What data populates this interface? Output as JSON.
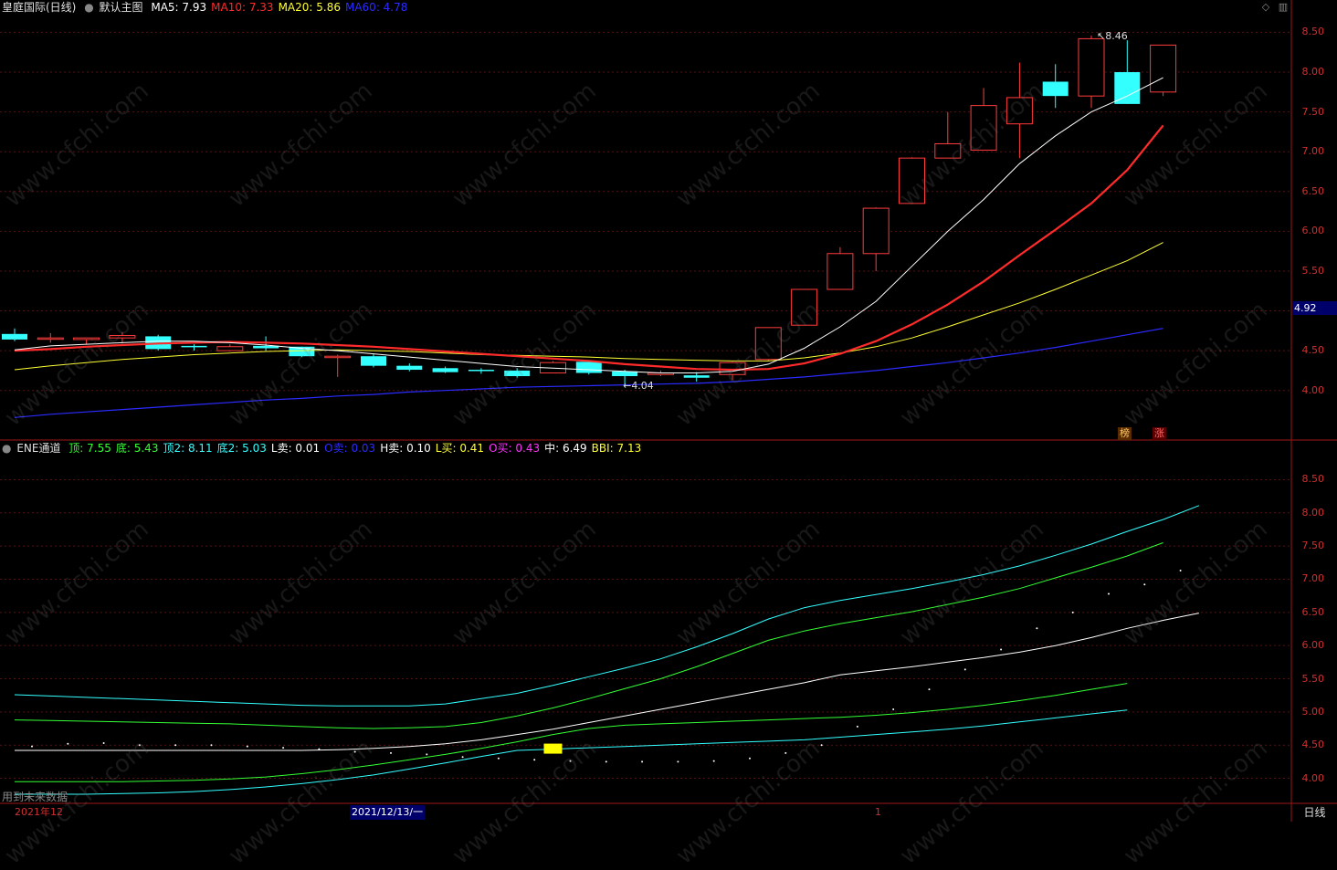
{
  "header": {
    "stock": "皇庭国际(日线)",
    "template": "默认主图",
    "ma": [
      {
        "label": "MA5: 7.93",
        "color": "#ffffff"
      },
      {
        "label": "MA10: 7.33",
        "color": "#ff2b2b"
      },
      {
        "label": "MA20: 5.86",
        "color": "#ffff33"
      },
      {
        "label": "MA60: 4.78",
        "color": "#2b2bff"
      }
    ]
  },
  "ene_header": {
    "name": "ENE通道",
    "items": [
      {
        "label": "顶: 7.55",
        "color": "#33ff33"
      },
      {
        "label": "底: 5.43",
        "color": "#33ff33"
      },
      {
        "label": "顶2: 8.11",
        "color": "#33ffff"
      },
      {
        "label": "底2: 5.03",
        "color": "#33ffff"
      },
      {
        "label": "L卖: 0.01",
        "color": "#ffffff"
      },
      {
        "label": "O卖: 0.03",
        "color": "#2b2bff"
      },
      {
        "label": "H卖: 0.10",
        "color": "#ffffff"
      },
      {
        "label": "L买: 0.41",
        "color": "#ffff33"
      },
      {
        "label": "O买: 0.43",
        "color": "#ff33ff"
      },
      {
        "label": "中: 6.49",
        "color": "#ffffff"
      },
      {
        "label": "BBI: 7.13",
        "color": "#ffff33"
      }
    ]
  },
  "main_axis": {
    "ticks": [
      "8.50",
      "8.00",
      "7.50",
      "7.00",
      "6.50",
      "6.00",
      "5.50",
      "5.00",
      "4.50",
      "4.00"
    ]
  },
  "sub_axis": {
    "ticks": [
      "8.50",
      "8.00",
      "7.50",
      "7.00",
      "6.50",
      "6.00",
      "5.50",
      "5.00",
      "4.50",
      "4.00"
    ]
  },
  "current_price": "4.92",
  "annotations": {
    "high": "8.46",
    "low": "4.04",
    "badge_1": "榜",
    "badge_2": "涨"
  },
  "footer": {
    "note": "用到未来数据",
    "time_left": "2021年12",
    "time_cursor": "2021/12/13/一",
    "time_mark": "1",
    "period": "日线"
  },
  "watermark": "www.cfchi.com",
  "chart_data": {
    "type": "candlestick",
    "candles": [
      {
        "o": 4.71,
        "h": 4.78,
        "l": 4.62,
        "c": 4.64
      },
      {
        "o": 4.66,
        "h": 4.72,
        "l": 4.6,
        "c": 4.66
      },
      {
        "o": 4.64,
        "h": 4.66,
        "l": 4.58,
        "c": 4.66
      },
      {
        "o": 4.66,
        "h": 4.73,
        "l": 4.59,
        "c": 4.69
      },
      {
        "o": 4.68,
        "h": 4.7,
        "l": 4.5,
        "c": 4.52
      },
      {
        "o": 4.56,
        "h": 4.58,
        "l": 4.5,
        "c": 4.55
      },
      {
        "o": 4.5,
        "h": 4.58,
        "l": 4.49,
        "c": 4.55
      },
      {
        "o": 4.56,
        "h": 4.68,
        "l": 4.5,
        "c": 4.53
      },
      {
        "o": 4.55,
        "h": 4.55,
        "l": 4.42,
        "c": 4.43
      },
      {
        "o": 4.43,
        "h": 4.45,
        "l": 4.17,
        "c": 4.43
      },
      {
        "o": 4.43,
        "h": 4.46,
        "l": 4.29,
        "c": 4.31
      },
      {
        "o": 4.31,
        "h": 4.34,
        "l": 4.24,
        "c": 4.26
      },
      {
        "o": 4.28,
        "h": 4.3,
        "l": 4.22,
        "c": 4.23
      },
      {
        "o": 4.26,
        "h": 4.28,
        "l": 4.21,
        "c": 4.25
      },
      {
        "o": 4.25,
        "h": 4.28,
        "l": 4.16,
        "c": 4.18
      },
      {
        "o": 4.22,
        "h": 4.37,
        "l": 4.22,
        "c": 4.35
      },
      {
        "o": 4.36,
        "h": 4.38,
        "l": 4.2,
        "c": 4.22
      },
      {
        "o": 4.24,
        "h": 4.26,
        "l": 4.04,
        "c": 4.18
      },
      {
        "o": 4.2,
        "h": 4.25,
        "l": 4.18,
        "c": 4.22
      },
      {
        "o": 4.19,
        "h": 4.23,
        "l": 4.11,
        "c": 4.16
      },
      {
        "o": 4.2,
        "h": 4.36,
        "l": 4.13,
        "c": 4.35
      },
      {
        "o": 4.39,
        "h": 4.78,
        "l": 4.37,
        "c": 4.79
      },
      {
        "o": 4.82,
        "h": 5.27,
        "l": 4.82,
        "c": 5.27
      },
      {
        "o": 5.27,
        "h": 5.8,
        "l": 5.27,
        "c": 5.72
      },
      {
        "o": 5.72,
        "h": 6.3,
        "l": 5.5,
        "c": 6.29
      },
      {
        "o": 6.35,
        "h": 6.93,
        "l": 6.35,
        "c": 6.92
      },
      {
        "o": 6.92,
        "h": 7.5,
        "l": 6.92,
        "c": 7.1
      },
      {
        "o": 7.02,
        "h": 7.8,
        "l": 7.02,
        "c": 7.58
      },
      {
        "o": 7.35,
        "h": 8.12,
        "l": 6.92,
        "c": 7.68
      },
      {
        "o": 7.88,
        "h": 8.1,
        "l": 7.55,
        "c": 7.7
      },
      {
        "o": 7.7,
        "h": 8.46,
        "l": 7.55,
        "c": 8.42
      },
      {
        "o": 8.0,
        "h": 8.4,
        "l": 7.6,
        "c": 7.6
      },
      {
        "o": 7.75,
        "h": 8.34,
        "l": 7.7,
        "c": 8.34
      }
    ],
    "ma5": [
      4.51,
      4.56,
      4.58,
      4.6,
      4.62,
      4.62,
      4.6,
      4.57,
      4.53,
      4.5,
      4.46,
      4.42,
      4.38,
      4.34,
      4.3,
      4.28,
      4.26,
      4.24,
      4.22,
      4.22,
      4.24,
      4.33,
      4.53,
      4.8,
      5.12,
      5.56,
      6.0,
      6.4,
      6.85,
      7.2,
      7.5,
      7.7,
      7.93
    ],
    "ma10": [
      4.5,
      4.52,
      4.55,
      4.57,
      4.59,
      4.6,
      4.61,
      4.6,
      4.59,
      4.57,
      4.55,
      4.52,
      4.49,
      4.46,
      4.43,
      4.4,
      4.37,
      4.33,
      4.3,
      4.27,
      4.26,
      4.27,
      4.34,
      4.46,
      4.62,
      4.83,
      5.08,
      5.37,
      5.7,
      6.02,
      6.35,
      6.77,
      7.33
    ],
    "ma20": [
      4.26,
      4.31,
      4.35,
      4.39,
      4.42,
      4.45,
      4.47,
      4.49,
      4.5,
      4.51,
      4.5,
      4.49,
      4.47,
      4.45,
      4.44,
      4.43,
      4.42,
      4.4,
      4.39,
      4.38,
      4.37,
      4.37,
      4.41,
      4.47,
      4.55,
      4.66,
      4.8,
      4.95,
      5.1,
      5.27,
      5.45,
      5.63,
      5.86
    ],
    "ma60": [
      3.66,
      3.7,
      3.73,
      3.76,
      3.79,
      3.82,
      3.85,
      3.88,
      3.9,
      3.93,
      3.95,
      3.98,
      4.0,
      4.02,
      4.04,
      4.05,
      4.06,
      4.07,
      4.08,
      4.09,
      4.11,
      4.14,
      4.17,
      4.21,
      4.25,
      4.3,
      4.35,
      4.41,
      4.47,
      4.54,
      4.62,
      4.7,
      4.78
    ],
    "ene": {
      "top2": [
        5.26,
        5.24,
        5.22,
        5.2,
        5.18,
        5.16,
        5.14,
        5.12,
        5.1,
        5.09,
        5.09,
        5.09,
        5.12,
        5.2,
        5.28,
        5.4,
        5.53,
        5.66,
        5.8,
        5.98,
        6.18,
        6.4,
        6.57,
        6.68,
        6.77,
        6.86,
        6.96,
        7.07,
        7.2,
        7.36,
        7.53,
        7.72,
        7.9,
        8.11
      ],
      "top": [
        4.88,
        4.87,
        4.86,
        4.85,
        4.84,
        4.83,
        4.82,
        4.8,
        4.78,
        4.76,
        4.75,
        4.76,
        4.78,
        4.84,
        4.94,
        5.06,
        5.2,
        5.35,
        5.5,
        5.68,
        5.88,
        6.08,
        6.22,
        6.33,
        6.42,
        6.51,
        6.62,
        6.73,
        6.86,
        7.02,
        7.18,
        7.35,
        7.55
      ],
      "mid": [
        4.42,
        4.42,
        4.42,
        4.42,
        4.42,
        4.42,
        4.42,
        4.42,
        4.42,
        4.43,
        4.45,
        4.48,
        4.52,
        4.58,
        4.66,
        4.74,
        4.84,
        4.94,
        5.04,
        5.14,
        5.24,
        5.34,
        5.44,
        5.56,
        5.62,
        5.68,
        5.75,
        5.82,
        5.9,
        6.0,
        6.12,
        6.26,
        6.38,
        6.49
      ],
      "bot": [
        3.95,
        3.95,
        3.95,
        3.95,
        3.96,
        3.97,
        3.99,
        4.02,
        4.07,
        4.13,
        4.2,
        4.28,
        4.36,
        4.45,
        4.55,
        4.66,
        4.75,
        4.8,
        4.82,
        4.84,
        4.86,
        4.88,
        4.9,
        4.92,
        4.95,
        4.99,
        5.04,
        5.1,
        5.17,
        5.25,
        5.34,
        5.43
      ],
      "bot2": [
        3.76,
        3.76,
        3.76,
        3.77,
        3.78,
        3.8,
        3.83,
        3.87,
        3.92,
        3.98,
        4.05,
        4.14,
        4.23,
        4.33,
        4.42,
        4.44,
        4.46,
        4.48,
        4.5,
        4.52,
        4.54,
        4.56,
        4.58,
        4.62,
        4.66,
        4.7,
        4.74,
        4.79,
        4.85,
        4.91,
        4.97,
        5.03
      ],
      "bbi": [
        4.48,
        4.52,
        4.53,
        4.5,
        4.5,
        4.5,
        4.48,
        4.46,
        4.44,
        4.4,
        4.38,
        4.36,
        4.32,
        4.3,
        4.28,
        4.26,
        4.25,
        4.25,
        4.25,
        4.26,
        4.3,
        4.38,
        4.5,
        4.78,
        5.04,
        5.34,
        5.64,
        5.94,
        6.26,
        6.5,
        6.78,
        6.92,
        7.13
      ],
      "signal_index": 15
    }
  }
}
